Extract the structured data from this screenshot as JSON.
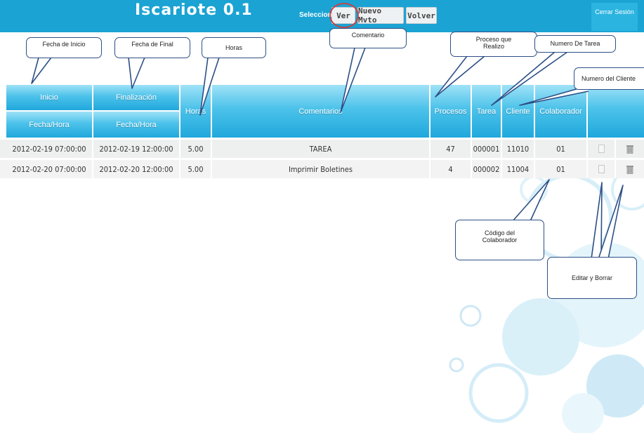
{
  "header": {
    "logo": "Iscariote 0.1",
    "select_label": "Seleccione:",
    "buttons": {
      "ver": "Ver",
      "nuevo": "Nuevo Mvto",
      "volver": "Volver"
    },
    "logout": "Cerrar Sesión",
    "colors": {
      "bar": "#1aa3d3",
      "logout": "#2bb4e0"
    }
  },
  "table": {
    "headers": {
      "inicio": "Inicio",
      "finalizacion": "Finalización",
      "fecha_hora_1": "Fecha/Hora",
      "fecha_hora_2": "Fecha/Hora",
      "horas": "Horas",
      "comentarios": "Comentarios",
      "procesos": "Procesos",
      "tarea": "Tarea",
      "cliente": "Cliente",
      "colaborador": "Colaborador"
    },
    "rows": [
      {
        "inicio": "2012-02-19 07:00:00",
        "final": "2012-02-19 12:00:00",
        "horas": "5.00",
        "comentario": "TAREA",
        "procesos": "47",
        "tarea": "000001",
        "cliente": "11010",
        "colaborador": "01"
      },
      {
        "inicio": "2012-02-20 07:00:00",
        "final": "2012-02-20 12:00:00",
        "horas": "5.00",
        "comentario": "Imprimir Boletines",
        "procesos": "4",
        "tarea": "000002",
        "cliente": "11004",
        "colaborador": "01"
      }
    ]
  },
  "callouts": {
    "fecha_inicio": "Fecha de Inicio",
    "fecha_final": "Fecha de Final",
    "horas": "Horas",
    "comentario": "Comentario",
    "proceso": "Proceso que Realizo",
    "numero_tarea": "Numero De Tarea",
    "numero_cliente": "Numero del Cliente",
    "codigo_colaborador": "Código del Colaborador",
    "editar_borrar": "Editar y Borrar"
  },
  "icons": [
    "edit-icon",
    "trash-icon"
  ]
}
